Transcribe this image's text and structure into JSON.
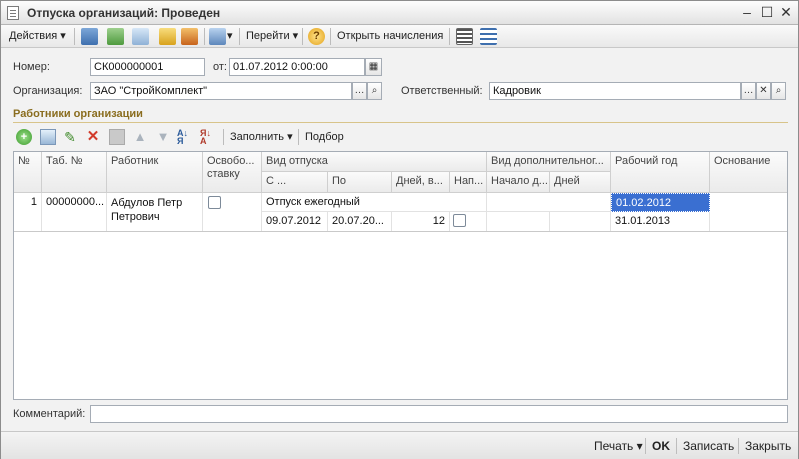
{
  "window": {
    "title": "Отпуска организаций: Проведен"
  },
  "toolbar": {
    "actions_label": "Действия",
    "goto_label": "Перейти",
    "open_accruals_label": "Открыть начисления"
  },
  "header": {
    "number_label": "Номер:",
    "number_value": "СК000000001",
    "date_label": "от:",
    "date_value": "01.07.2012  0:00:00",
    "org_label": "Организация:",
    "org_value": "ЗАО \"СтройКомплект\"",
    "responsible_label": "Ответственный:",
    "responsible_value": "Кадровик"
  },
  "section": {
    "title": "Работники организации",
    "fill_label": "Заполнить",
    "select_label": "Подбор"
  },
  "table": {
    "headers": {
      "num": "№",
      "tab_num": "Таб. №",
      "employee": "Работник",
      "free_rate": "Освобо...",
      "free_rate2": "ставку",
      "leave_type": "Вид отпуска",
      "from": "С ...",
      "to": "По",
      "days": "Дней, в...",
      "dir": "Нап...",
      "extra_type": "Вид дополнительног...",
      "extra_start": "Начало д...",
      "extra_days": "Дней",
      "work_year": "Рабочий год",
      "basis": "Основание"
    },
    "row": {
      "num": "1",
      "tab_num": "00000000...",
      "employee_line1": "Абдулов Петр",
      "employee_line2": "Петрович",
      "leave_type": "Отпуск ежегодный",
      "from": "09.07.2012",
      "to": "20.07.20...",
      "days": "12",
      "work_year_from": "01.02.2012",
      "work_year_to": "31.01.2013"
    }
  },
  "comment": {
    "label": "Комментарий:",
    "value": ""
  },
  "footer": {
    "print_label": "Печать",
    "ok_label": "OK",
    "save_label": "Записать",
    "close_label": "Закрыть"
  },
  "colors": {
    "section_title": "#8a6d1f",
    "selection": "#3a6fd1"
  }
}
